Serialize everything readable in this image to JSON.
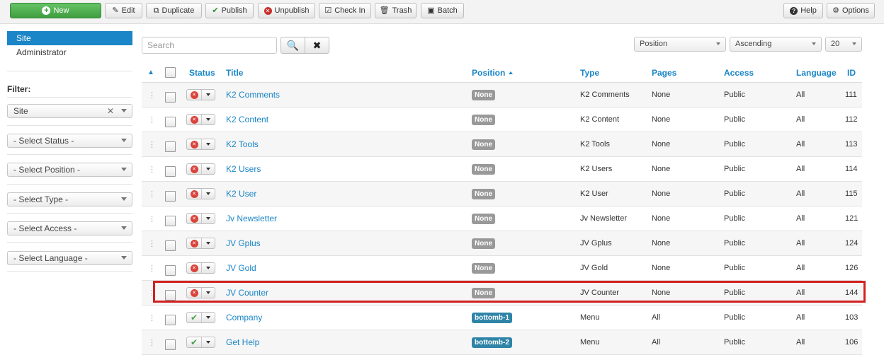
{
  "toolbar": {
    "new": "New",
    "edit": "Edit",
    "duplicate": "Duplicate",
    "publish": "Publish",
    "unpublish": "Unpublish",
    "checkin": "Check In",
    "trash": "Trash",
    "batch": "Batch",
    "help": "Help",
    "options": "Options"
  },
  "sidebar": {
    "items": [
      {
        "label": "Site",
        "active": true
      },
      {
        "label": "Administrator",
        "active": false
      }
    ],
    "filter_label": "Filter:",
    "filters": {
      "client": "Site",
      "status": "- Select Status -",
      "position": "- Select Position -",
      "type": "- Select Type -",
      "access": "- Select Access -",
      "language": "- Select Language -"
    }
  },
  "search": {
    "placeholder": "Search"
  },
  "list_controls": {
    "order_by": "Position",
    "direction": "Ascending",
    "limit": "20"
  },
  "table": {
    "headers": {
      "status": "Status",
      "title": "Title",
      "position": "Position",
      "type": "Type",
      "pages": "Pages",
      "access": "Access",
      "language": "Language",
      "id": "ID"
    },
    "rows": [
      {
        "title": "K2 Comments",
        "position": "None",
        "type": "K2 Comments",
        "pages": "None",
        "access": "Public",
        "language": "All",
        "id": "111",
        "published": false
      },
      {
        "title": "K2 Content",
        "position": "None",
        "type": "K2 Content",
        "pages": "None",
        "access": "Public",
        "language": "All",
        "id": "112",
        "published": false
      },
      {
        "title": "K2 Tools",
        "position": "None",
        "type": "K2 Tools",
        "pages": "None",
        "access": "Public",
        "language": "All",
        "id": "113",
        "published": false
      },
      {
        "title": "K2 Users",
        "position": "None",
        "type": "K2 Users",
        "pages": "None",
        "access": "Public",
        "language": "All",
        "id": "114",
        "published": false
      },
      {
        "title": "K2 User",
        "position": "None",
        "type": "K2 User",
        "pages": "None",
        "access": "Public",
        "language": "All",
        "id": "115",
        "published": false
      },
      {
        "title": "Jv Newsletter",
        "position": "None",
        "type": "Jv Newsletter",
        "pages": "None",
        "access": "Public",
        "language": "All",
        "id": "121",
        "published": false
      },
      {
        "title": "JV Gplus",
        "position": "None",
        "type": "JV Gplus",
        "pages": "None",
        "access": "Public",
        "language": "All",
        "id": "124",
        "published": false
      },
      {
        "title": "JV Gold",
        "position": "None",
        "type": "JV Gold",
        "pages": "None",
        "access": "Public",
        "language": "All",
        "id": "126",
        "published": false
      },
      {
        "title": "JV Counter",
        "position": "None",
        "type": "JV Counter",
        "pages": "None",
        "access": "Public",
        "language": "All",
        "id": "144",
        "published": false
      },
      {
        "title": "Company",
        "position": "bottomb-1",
        "type": "Menu",
        "pages": "All",
        "access": "Public",
        "language": "All",
        "id": "103",
        "published": true
      },
      {
        "title": "Get Help",
        "position": "bottomb-2",
        "type": "Menu",
        "pages": "All",
        "access": "Public",
        "language": "All",
        "id": "106",
        "published": true
      }
    ]
  },
  "colors": {
    "accent": "#1a85c7",
    "highlight": "#d32020",
    "new_button": "#4cae4c"
  }
}
